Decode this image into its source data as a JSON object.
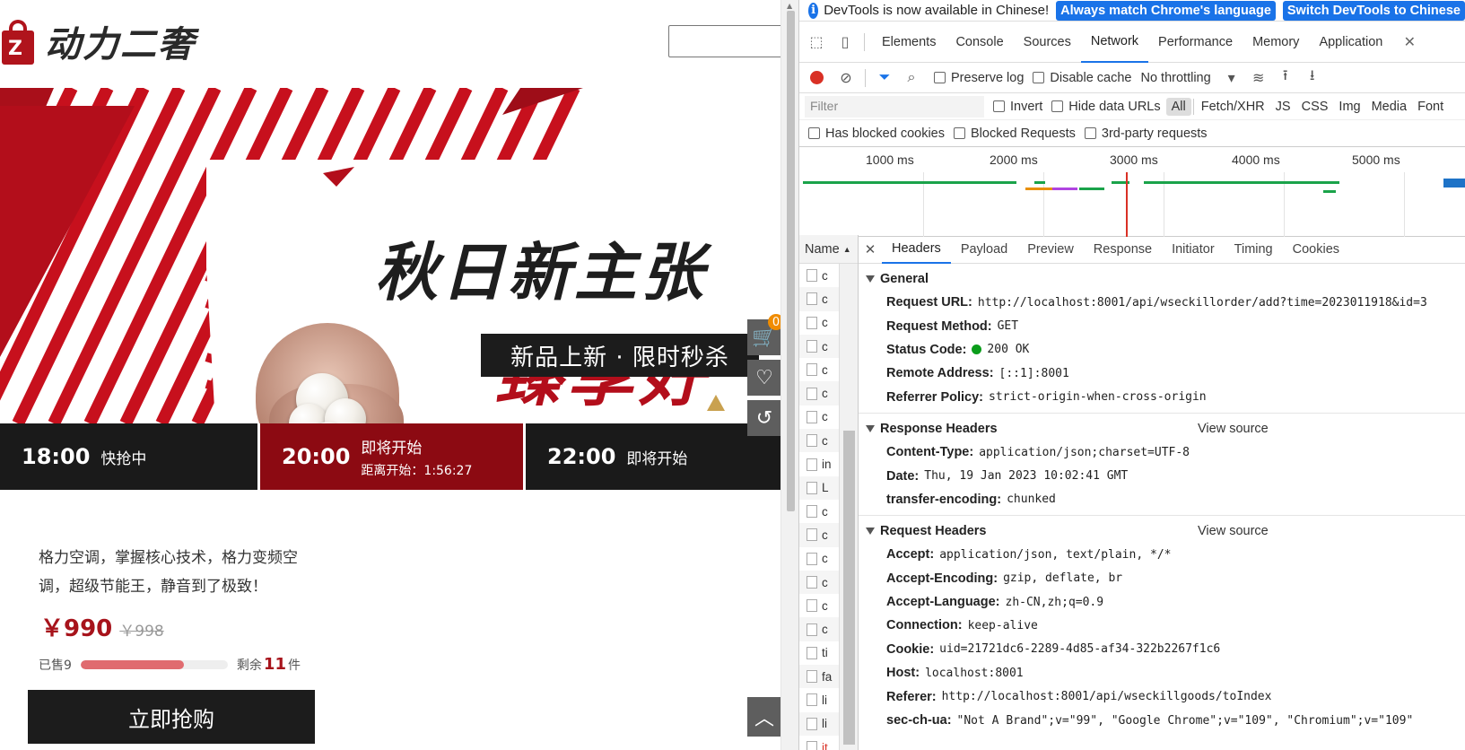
{
  "page": {
    "brand": "动力二奢",
    "banner_title": "秋日新主张",
    "banner_subtitle": "臻享好礼",
    "banner_tag": "新品上新 · 限时秒杀",
    "slots": [
      {
        "time": "18:00",
        "status": "快抢中",
        "countdown": ""
      },
      {
        "time": "20:00",
        "status": "即将开始",
        "countdown": "距离开始：1:56:27"
      },
      {
        "time": "22:00",
        "status": "即将开始",
        "countdown": ""
      }
    ],
    "cart_count": "0",
    "product_desc": "格力空调，掌握核心技术，格力变频空调，超级节能王，静音到了极致！",
    "price_now": "￥990",
    "price_old": "￥998",
    "sold_label": "已售9",
    "sold_ratio": 0.7,
    "remain_prefix": "剩余",
    "remain_num": "11",
    "remain_unit": "件",
    "buy_label": "立即抢购"
  },
  "devtools": {
    "info_msg": "DevTools is now available in Chinese!",
    "info_btn1": "Always match Chrome's language",
    "info_btn2": "Switch DevTools to Chinese",
    "tabs": [
      "Elements",
      "Console",
      "Sources",
      "Network",
      "Performance",
      "Memory",
      "Application"
    ],
    "active_tab": "Network",
    "toolbar": {
      "preserve_log": "Preserve log",
      "disable_cache": "Disable cache",
      "throttle": "No throttling"
    },
    "filter_placeholder": "Filter",
    "invert": "Invert",
    "hide_data_urls": "Hide data URLs",
    "types": [
      "All",
      "Fetch/XHR",
      "JS",
      "CSS",
      "Img",
      "Media",
      "Font"
    ],
    "blocked": [
      "Has blocked cookies",
      "Blocked Requests",
      "3rd-party requests"
    ],
    "ticks": [
      "1000 ms",
      "2000 ms",
      "3000 ms",
      "4000 ms",
      "5000 ms"
    ],
    "name_header": "Name",
    "name_rows": [
      "c",
      "c",
      "c",
      "c",
      "c",
      "c",
      "c",
      "c",
      "in",
      "L",
      "c",
      "c",
      "c",
      "c",
      "c",
      "c",
      "ti",
      "fa",
      "li",
      "li",
      "it"
    ],
    "detail_tabs": [
      "Headers",
      "Payload",
      "Preview",
      "Response",
      "Initiator",
      "Timing",
      "Cookies"
    ],
    "general_title": "General",
    "general": [
      {
        "k": "Request URL:",
        "v": "http://localhost:8001/api/wseckillorder/add?time=2023011918&id=3"
      },
      {
        "k": "Request Method:",
        "v": "GET"
      },
      {
        "k": "Status Code:",
        "v": "200 OK"
      },
      {
        "k": "Remote Address:",
        "v": "[::1]:8001"
      },
      {
        "k": "Referrer Policy:",
        "v": "strict-origin-when-cross-origin"
      }
    ],
    "response_title": "Response Headers",
    "view_source": "View source",
    "response": [
      {
        "k": "Content-Type:",
        "v": "application/json;charset=UTF-8"
      },
      {
        "k": "Date:",
        "v": "Thu, 19 Jan 2023 10:02:41 GMT"
      },
      {
        "k": "transfer-encoding:",
        "v": "chunked"
      }
    ],
    "request_title": "Request Headers",
    "request": [
      {
        "k": "Accept:",
        "v": "application/json, text/plain, */*"
      },
      {
        "k": "Accept-Encoding:",
        "v": "gzip, deflate, br"
      },
      {
        "k": "Accept-Language:",
        "v": "zh-CN,zh;q=0.9"
      },
      {
        "k": "Connection:",
        "v": "keep-alive"
      },
      {
        "k": "Cookie:",
        "v": "uid=21721dc6-2289-4d85-af34-322b2267f1c6"
      },
      {
        "k": "Host:",
        "v": "localhost:8001"
      },
      {
        "k": "Referer:",
        "v": "http://localhost:8001/api/wseckillgoods/toIndex"
      },
      {
        "k": "sec-ch-ua:",
        "v": "\"Not A Brand\";v=\"99\", \"Google Chrome\";v=\"109\", \"Chromium\";v=\"109\""
      }
    ],
    "colors": {
      "accent": "#1a73e8",
      "record": "#d93025",
      "status_ok": "#0b9d1b"
    }
  }
}
